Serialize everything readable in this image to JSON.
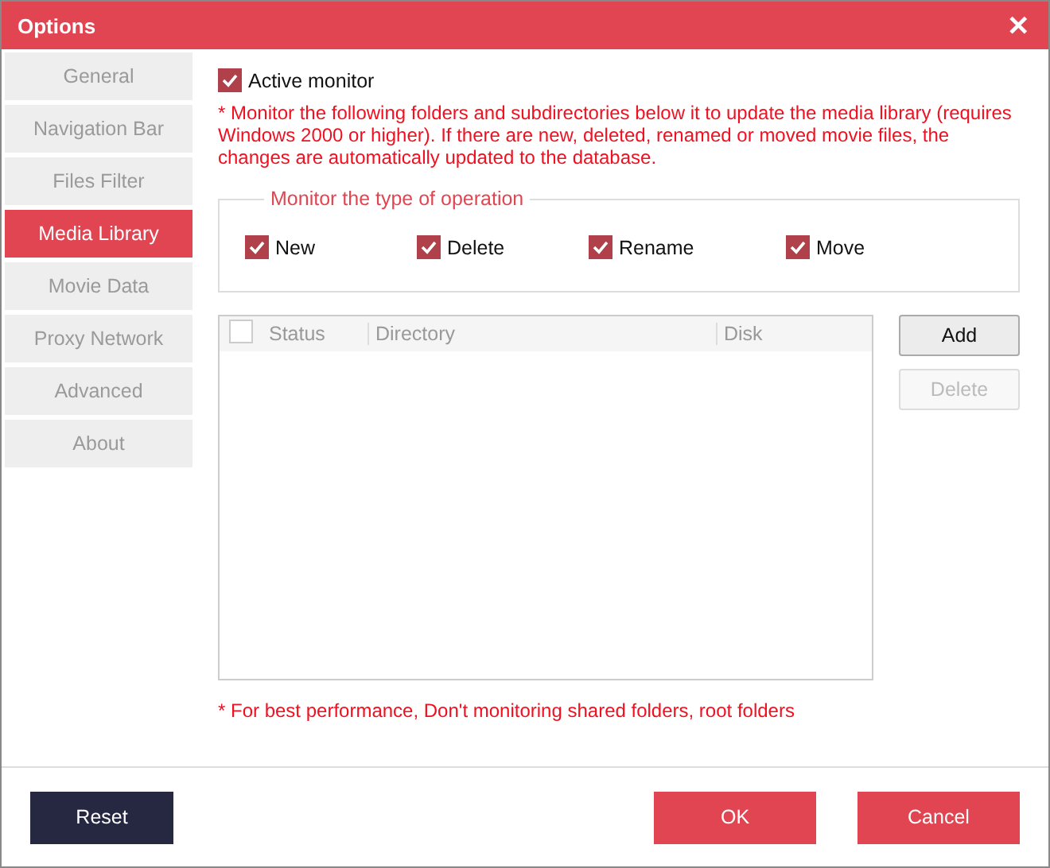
{
  "window": {
    "title": "Options",
    "close": "✕"
  },
  "sidebar": {
    "items": [
      {
        "label": "General",
        "selected": false
      },
      {
        "label": "Navigation Bar",
        "selected": false
      },
      {
        "label": "Files Filter",
        "selected": false
      },
      {
        "label": "Media Library",
        "selected": true
      },
      {
        "label": "Movie Data",
        "selected": false
      },
      {
        "label": "Proxy Network",
        "selected": false
      },
      {
        "label": "Advanced",
        "selected": false
      },
      {
        "label": "About",
        "selected": false
      }
    ]
  },
  "active_monitor": {
    "label": "Active monitor",
    "checked": true
  },
  "note": "* Monitor the following folders and subdirectories below it to update the media library (requires Windows 2000 or higher). If there are new, deleted, renamed or moved movie files, the changes are automatically updated to the database.",
  "operations": {
    "title": "Monitor the type of operation",
    "items": [
      {
        "label": "New",
        "checked": true
      },
      {
        "label": "Delete",
        "checked": true
      },
      {
        "label": "Rename",
        "checked": true
      },
      {
        "label": "Move",
        "checked": true
      }
    ]
  },
  "table": {
    "select_all": {
      "checked": false
    },
    "columns": [
      "Status",
      "Directory",
      "Disk"
    ]
  },
  "side_buttons": [
    {
      "label": "Add",
      "disabled": false
    },
    {
      "label": "Delete",
      "disabled": true
    }
  ],
  "footnote": "* For best performance, Don't monitoring shared folders, root folders",
  "footer": {
    "reset": "Reset",
    "ok": "OK",
    "cancel": "Cancel"
  }
}
